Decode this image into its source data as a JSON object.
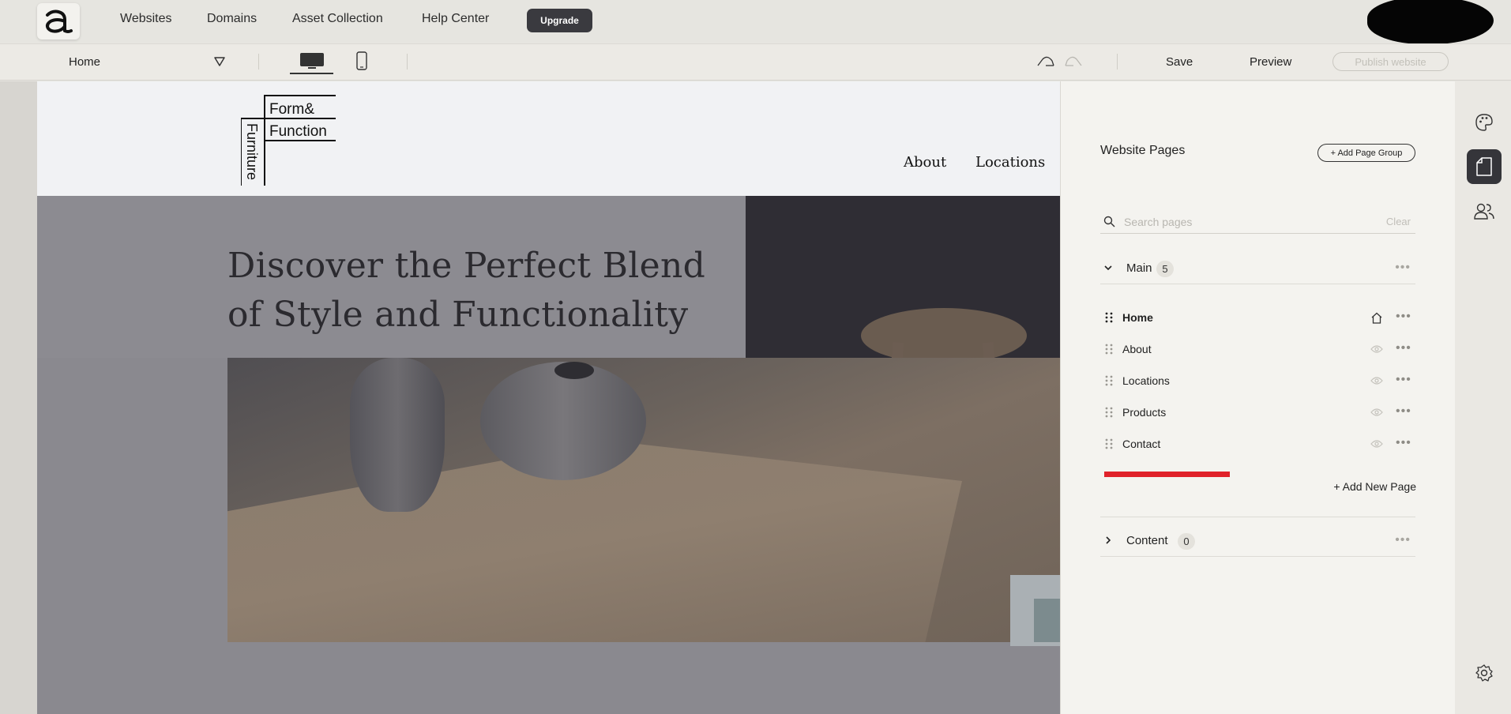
{
  "topnav": {
    "logo_alt": "a",
    "links": [
      "Websites",
      "Domains",
      "Asset Collection",
      "Help Center"
    ],
    "upgrade_label": "Upgrade"
  },
  "toolbar": {
    "current_page": "Home",
    "save_label": "Save",
    "preview_label": "Preview",
    "publish_label": "Publish website",
    "device": "desktop"
  },
  "site": {
    "logo": {
      "line1": "Form&",
      "line2": "Function",
      "vertical": "Furniture"
    },
    "nav": [
      "About",
      "Locations"
    ],
    "hero_title_line1": "Discover the Perfect Blend",
    "hero_title_line2": "of Style and Functionality"
  },
  "panel": {
    "title": "Website Pages",
    "add_group_label": "+ Add Page Group",
    "search_placeholder": "Search pages",
    "search_value": "",
    "clear_label": "Clear",
    "groups": [
      {
        "name": "Main",
        "count": "5",
        "expanded": true
      },
      {
        "name": "Content",
        "count": "0",
        "expanded": false
      }
    ],
    "pages": [
      {
        "name": "Home",
        "active": true,
        "icon": "home-icon"
      },
      {
        "name": "About",
        "active": false,
        "icon": "eye-icon"
      },
      {
        "name": "Locations",
        "active": false,
        "icon": "eye-icon"
      },
      {
        "name": "Products",
        "active": false,
        "icon": "eye-icon"
      },
      {
        "name": "Contact",
        "active": false,
        "icon": "eye-icon"
      }
    ],
    "add_page_label": "+ Add New Page"
  },
  "rail": {
    "items": [
      "palette-icon",
      "page-icon",
      "users-icon",
      "settings-icon"
    ],
    "active": "page-icon"
  },
  "colors": {
    "accent_red": "#e0222a",
    "dark": "#35353a",
    "panel_bg": "#f4f3ef"
  }
}
